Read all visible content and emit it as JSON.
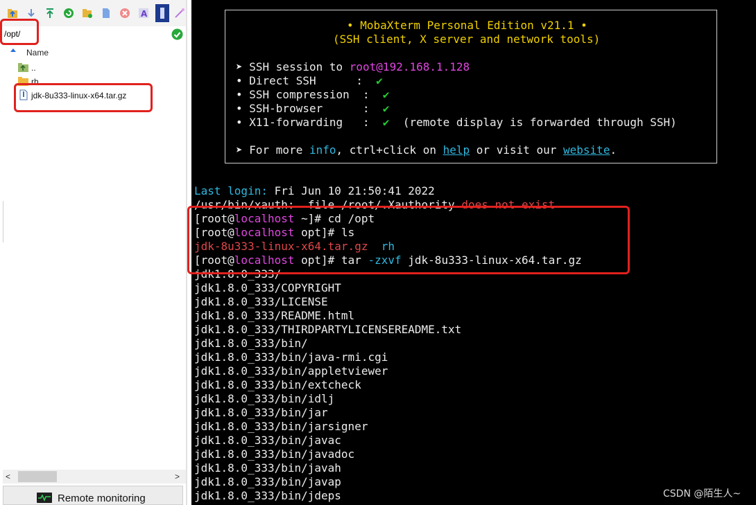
{
  "file_browser": {
    "toolbar_icons": [
      "parent-folder-icon",
      "download-icon",
      "upload-icon",
      "refresh-icon",
      "new-folder-icon",
      "new-file-icon",
      "delete-icon",
      "rename-icon",
      "properties-icon",
      "settings-icon"
    ],
    "path": "/opt/",
    "column_name": "Name",
    "entries": [
      {
        "name": "..",
        "icon": "parent-folder-icon"
      },
      {
        "name": "rh",
        "icon": "folder-icon"
      },
      {
        "name": "jdk-8u333-linux-x64.tar.gz",
        "icon": "archive-file-icon"
      }
    ],
    "remote_monitoring_label": "Remote monitoring"
  },
  "banner": {
    "title_line": "• MobaXterm Personal Edition v21.1 •",
    "subtitle_line": "(SSH client, X server and network tools)",
    "session_prefix": "➤ SSH session to ",
    "session_host": "root@192.168.1.128",
    "features": [
      {
        "label": "• Direct SSH      :  ",
        "mark": "✔",
        "note": ""
      },
      {
        "label": "• SSH compression  :  ",
        "mark": "✔",
        "note": ""
      },
      {
        "label": "• SSH-browser      :  ",
        "mark": "✔",
        "note": ""
      },
      {
        "label": "• X11-forwarding   :  ",
        "mark": "✔",
        "note": "  (remote display is forwarded through SSH)"
      }
    ],
    "more_prefix": "➤ For more ",
    "more_info": "info",
    "more_mid": ", ctrl+click on ",
    "more_help": "help",
    "more_mid2": " or visit our ",
    "more_website": "website",
    "more_end": "."
  },
  "terminal": {
    "last_login_label": "Last login:",
    "last_login_value": " Fri Jun 10 21:50:41 2022",
    "xauth_prefix": "/usr/bin/xauth:  file /root/.Xauthority ",
    "xauth_warn": "does not exist",
    "prompt_open": "[root@",
    "prompt_host": "localhost",
    "cmd1_dir": " ~]# ",
    "cmd1": "cd /opt",
    "cmd2_dir": " opt]# ",
    "cmd2": "ls",
    "ls_file": "jdk-8u333-linux-x64.tar.gz",
    "ls_dir": "rh",
    "cmd3_dir": " opt]# ",
    "cmd3_tar": "tar ",
    "cmd3_flags": "-zxvf",
    "cmd3_arg": " jdk-8u333-linux-x64.tar.gz",
    "output_lines": [
      "jdk1.8.0_333/",
      "jdk1.8.0_333/COPYRIGHT",
      "jdk1.8.0_333/LICENSE",
      "jdk1.8.0_333/README.html",
      "jdk1.8.0_333/THIRDPARTYLICENSEREADME.txt",
      "jdk1.8.0_333/bin/",
      "jdk1.8.0_333/bin/java-rmi.cgi",
      "jdk1.8.0_333/bin/appletviewer",
      "jdk1.8.0_333/bin/extcheck",
      "jdk1.8.0_333/bin/idlj",
      "jdk1.8.0_333/bin/jar",
      "jdk1.8.0_333/bin/jarsigner",
      "jdk1.8.0_333/bin/javac",
      "jdk1.8.0_333/bin/javadoc",
      "jdk1.8.0_333/bin/javah",
      "jdk1.8.0_333/bin/javap",
      "jdk1.8.0_333/bin/jdeps"
    ]
  },
  "watermark": "CSDN @陌生人~",
  "colors": {
    "terminal_bg": "#000000",
    "highlight_red": "#e0211e",
    "prompt_host": "#e046e0",
    "yellow": "#f0d000",
    "green": "#25cc34",
    "cyan": "#2fb8e0",
    "warn_red": "#e0474a"
  }
}
